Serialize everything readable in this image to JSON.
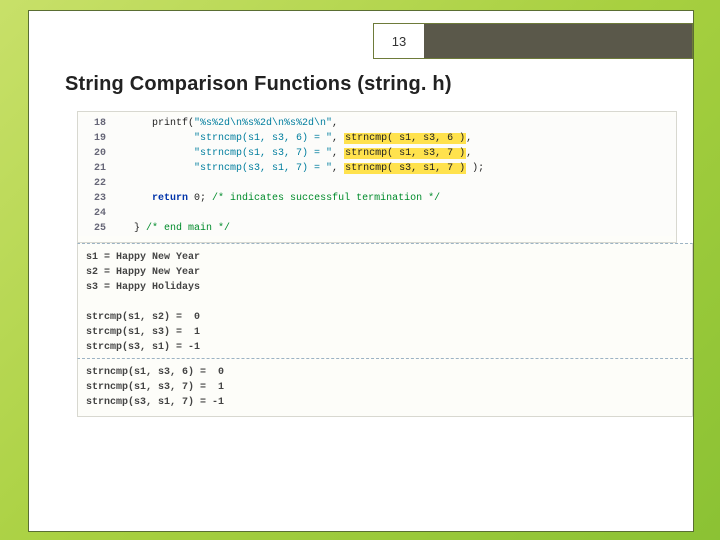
{
  "page_number": "13",
  "title": "String Comparison Functions (string. h)",
  "code": {
    "lines": [
      {
        "no": "18",
        "pre": "      printf(",
        "str": "\"%s%2d\\n%s%2d\\n%s%2d\\n\"",
        "post": ","
      },
      {
        "no": "19",
        "pre": "             ",
        "str": "\"strncmp(s1, s3, 6) = \"",
        "post": ", ",
        "hl": "strncmp( s1, s3, 6 )",
        "tail": ","
      },
      {
        "no": "20",
        "pre": "             ",
        "str": "\"strncmp(s1, s3, 7) = \"",
        "post": ", ",
        "hl": "strncmp( s1, s3, 7 )",
        "tail": ","
      },
      {
        "no": "21",
        "pre": "             ",
        "str": "\"strncmp(s3, s1, 7) = \"",
        "post": ", ",
        "hl": "strncmp( s3, s1, 7 )",
        "tail": " );"
      },
      {
        "no": "22",
        "pre": "",
        "str": "",
        "post": ""
      },
      {
        "no": "23",
        "pre": "      ",
        "kw": "return",
        "post2": " 0; ",
        "com": "/* indicates successful termination */"
      },
      {
        "no": "24",
        "pre": "",
        "str": "",
        "post": ""
      },
      {
        "no": "25",
        "pre": "   } ",
        "com": "/* end main */"
      }
    ]
  },
  "output1": "s1 = Happy New Year\ns2 = Happy New Year\ns3 = Happy Holidays\n\nstrcmp(s1, s2) =  0\nstrcmp(s1, s3) =  1\nstrcmp(s3, s1) = -1",
  "output2": "strncmp(s1, s3, 6) =  0\nstrncmp(s1, s3, 7) =  1\nstrncmp(s3, s1, 7) = -1"
}
